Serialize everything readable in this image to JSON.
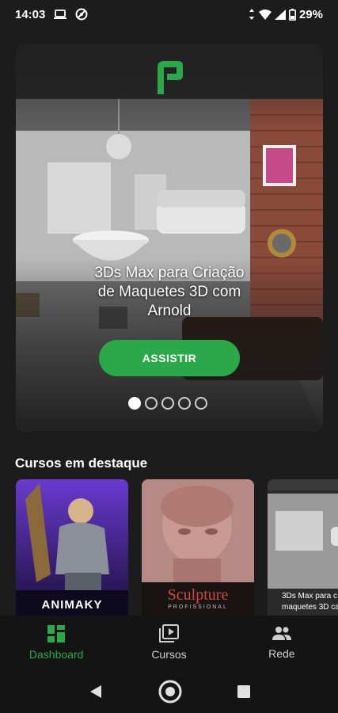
{
  "status_bar": {
    "time": "14:03",
    "battery": "29%",
    "icons": [
      "laptop-icon",
      "blocked-icon",
      "vibrate-icon",
      "wifi-icon",
      "signal-icon",
      "battery-icon"
    ]
  },
  "hero": {
    "logo_icon": "brand-f-logo",
    "title_line1": "3Ds Max para Criação",
    "title_line2": "de Maquetes 3D com",
    "title_line3": "Arnold",
    "button_label": "ASSISTIR",
    "slides_total": 5,
    "active_slide": 1
  },
  "featured": {
    "title": "Cursos em destaque",
    "cards": [
      {
        "label": "ANIMAKY"
      },
      {
        "label": "Sculpture",
        "sublabel": "PROFISSIONAL"
      },
      {
        "label": "3Ds Max para c",
        "sublabel": "maquetes 3D ca"
      }
    ]
  },
  "bottom_nav": {
    "items": [
      {
        "label": "Dashboard",
        "icon": "dashboard-icon",
        "active": true
      },
      {
        "label": "Cursos",
        "icon": "play-library-icon",
        "active": false
      },
      {
        "label": "Rede",
        "icon": "people-icon",
        "active": false
      }
    ]
  },
  "colors": {
    "accent": "#2aa84a",
    "background": "#1c1c1c",
    "nav_background": "#141414"
  }
}
